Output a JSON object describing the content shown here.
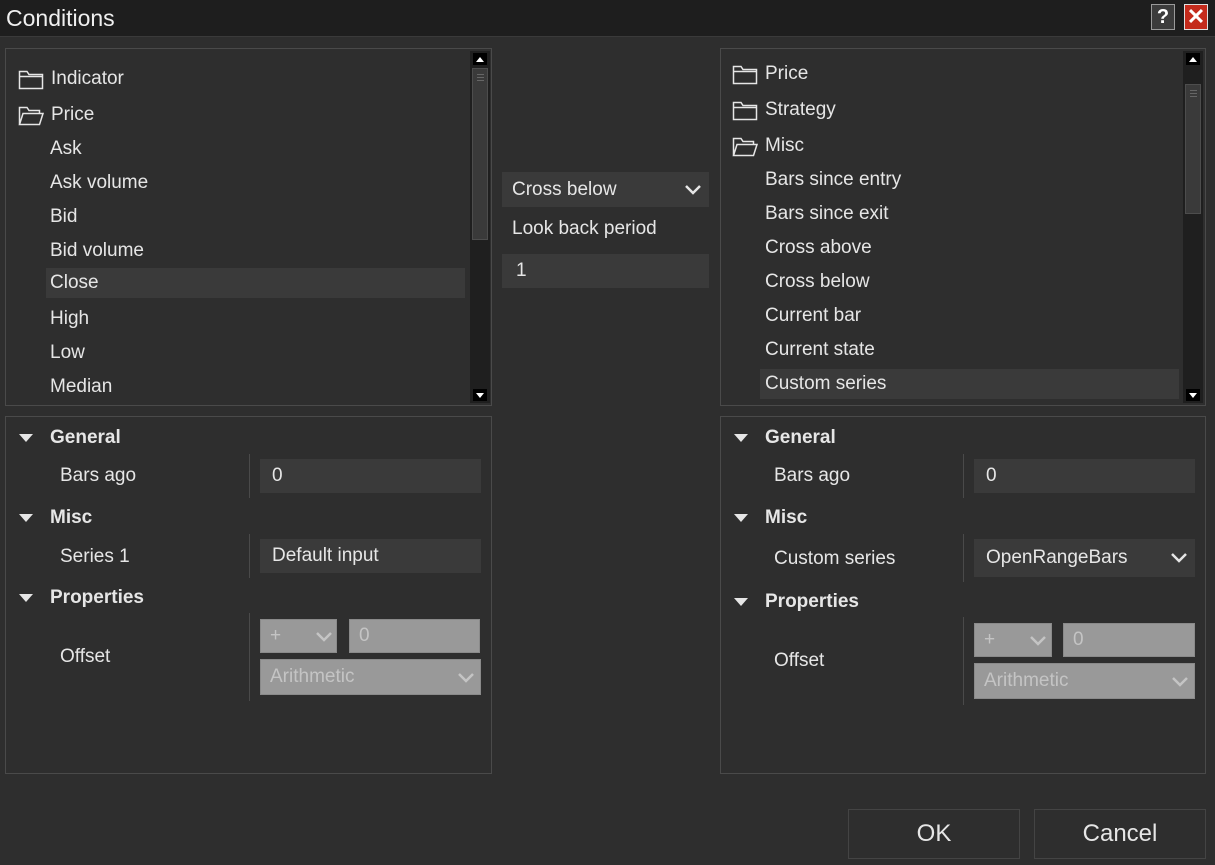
{
  "window": {
    "title": "Conditions",
    "help_label": "?",
    "close_label": "✕"
  },
  "left_tree": {
    "items": [
      {
        "label": "Indicator",
        "icon": "folder-closed-icon"
      },
      {
        "label": "Price",
        "icon": "folder-open-icon"
      },
      {
        "label": "Ask"
      },
      {
        "label": "Ask volume"
      },
      {
        "label": "Bid"
      },
      {
        "label": "Bid volume"
      },
      {
        "label": "Close",
        "selected": true
      },
      {
        "label": "High"
      },
      {
        "label": "Low"
      },
      {
        "label": "Median"
      }
    ]
  },
  "middle": {
    "operator": "Cross below",
    "lookback_label": "Look back period",
    "lookback_value": "1"
  },
  "right_tree": {
    "items": [
      {
        "label": "Price",
        "icon": "folder-closed-icon"
      },
      {
        "label": "Strategy",
        "icon": "folder-closed-icon"
      },
      {
        "label": "Misc",
        "icon": "folder-open-icon"
      },
      {
        "label": "Bars since entry"
      },
      {
        "label": "Bars since exit"
      },
      {
        "label": "Cross above"
      },
      {
        "label": "Cross below"
      },
      {
        "label": "Current bar"
      },
      {
        "label": "Current state"
      },
      {
        "label": "Custom series",
        "selected": true
      }
    ]
  },
  "left_props": {
    "general_label": "General",
    "bars_ago_label": "Bars ago",
    "bars_ago_value": "0",
    "misc_label": "Misc",
    "series_label": "Series 1",
    "series_value": "Default input",
    "properties_label": "Properties",
    "offset_label": "Offset",
    "offset_sign": "+",
    "offset_value": "0",
    "offset_type": "Arithmetic"
  },
  "right_props": {
    "general_label": "General",
    "bars_ago_label": "Bars ago",
    "bars_ago_value": "0",
    "misc_label": "Misc",
    "custom_series_label": "Custom series",
    "custom_series_value": "OpenRangeBars",
    "properties_label": "Properties",
    "offset_label": "Offset",
    "offset_sign": "+",
    "offset_value": "0",
    "offset_type": "Arithmetic"
  },
  "buttons": {
    "ok": "OK",
    "cancel": "Cancel"
  },
  "colors": {
    "background": "#2e2e2e",
    "titlebar": "#1e1e1e",
    "input": "#3a3a3a",
    "close": "#c42b1c",
    "disabled": "#999999"
  }
}
